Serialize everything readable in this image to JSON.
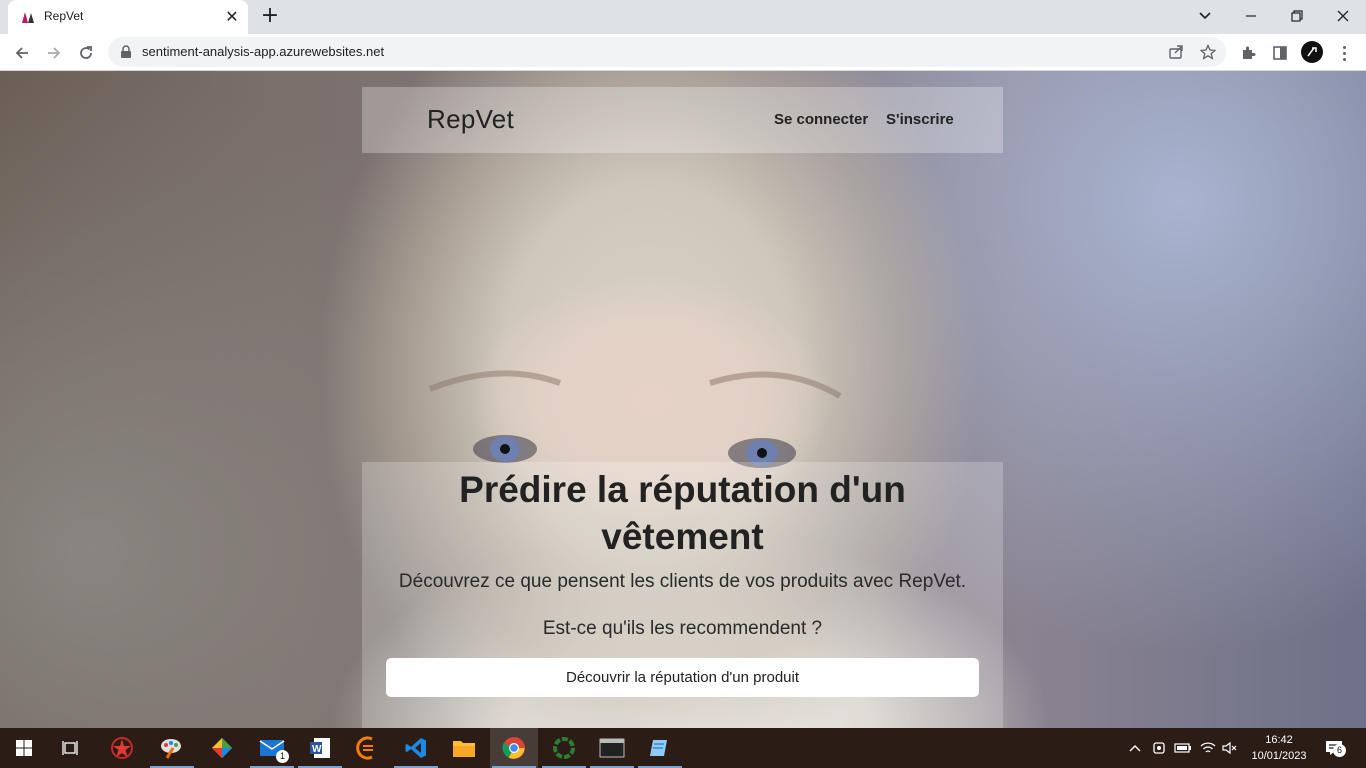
{
  "browser": {
    "tab_title": "RepVet",
    "url": "sentiment-analysis-app.azurewebsites.net",
    "icons": [
      "back-icon",
      "forward-icon",
      "reload-icon",
      "lock-icon",
      "share-icon",
      "bookmark-star-icon",
      "extensions-icon",
      "side-panel-icon",
      "profile-avatar",
      "menu-icon",
      "minimize-icon",
      "restore-icon",
      "close-icon",
      "tab-search-icon"
    ]
  },
  "site": {
    "brand": "RepVet",
    "nav": {
      "login": "Se connecter",
      "signup": "S'inscrire"
    },
    "hero": {
      "title_line1": "Prédire la réputation d'un",
      "title_line2": "vêtement",
      "subtitle": "Découvrez ce que pensent les clients de vos produits avec RepVet.",
      "question": "Est-ce qu'ils les recommendent ?",
      "cta": "Découvrir la réputation d'un produit"
    }
  },
  "taskbar": {
    "clock_time": "16:42",
    "clock_date": "10/01/2023",
    "mail_badge": "1",
    "notifications_badge": "6",
    "apps": [
      "start",
      "task-view",
      "app-red-star",
      "app-paint",
      "app-multicolor",
      "mail",
      "word",
      "eclipse",
      "vscode",
      "file-explorer",
      "chrome",
      "app-green-ring",
      "terminal",
      "app-notepad"
    ]
  },
  "colors": {
    "taskbar": "#2b1d16",
    "chrome_bg": "#dee1e6",
    "accent": "#1a73e8"
  }
}
